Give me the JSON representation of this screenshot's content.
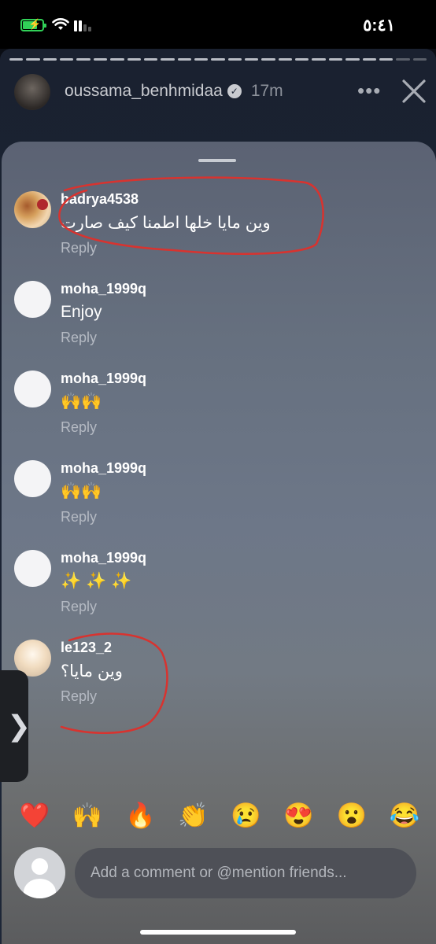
{
  "status_bar": {
    "time": "٥:٤١",
    "battery_charging": true
  },
  "story": {
    "username": "oussama_benhmidaa",
    "time_ago": "17m",
    "verified_icon": "verified-badge-icon",
    "more_icon": "more-icon",
    "close_icon": "close-icon"
  },
  "comments": [
    {
      "username": "badrya4538",
      "text": "وين مايا خلها اطمنا كيف صارت",
      "reply_label": "Reply"
    },
    {
      "username": "moha_1999q",
      "text": "Enjoy",
      "reply_label": "Reply"
    },
    {
      "username": "moha_1999q",
      "text": "🙌🙌",
      "reply_label": "Reply"
    },
    {
      "username": "moha_1999q",
      "text": "🙌🙌",
      "reply_label": "Reply"
    },
    {
      "username": "moha_1999q",
      "text": "✨ ✨ ✨",
      "reply_label": "Reply"
    },
    {
      "username": "le123_2",
      "text": "وين مايا؟",
      "reply_label": "Reply"
    }
  ],
  "quick_reactions": [
    "❤️",
    "🙌",
    "🔥",
    "👏",
    "😢",
    "😍",
    "😮",
    "😂"
  ],
  "composer": {
    "placeholder": "Add a comment or @mention friends..."
  },
  "colors": {
    "annotation_red": "#d8332f",
    "battery_green": "#31d158"
  }
}
